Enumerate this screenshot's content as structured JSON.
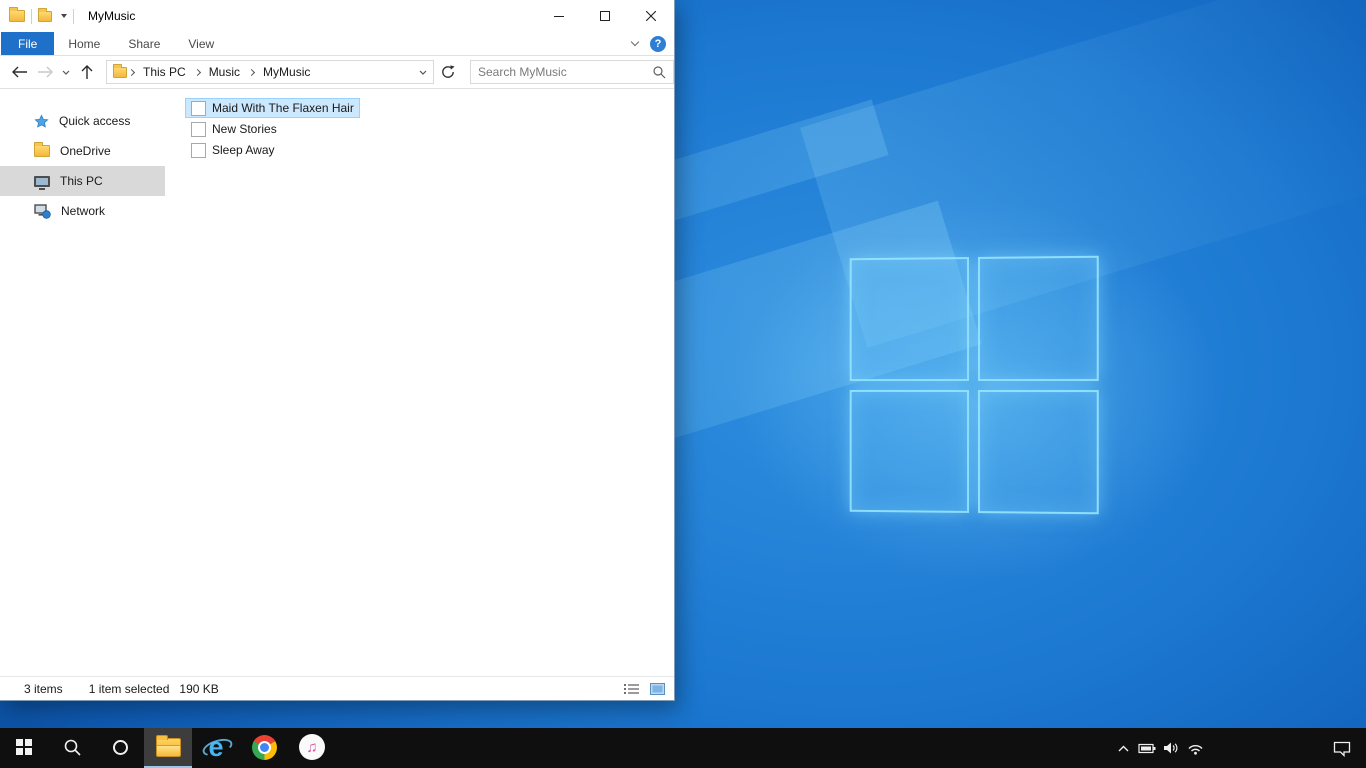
{
  "explorer": {
    "titlebar": {
      "title": "MyMusic"
    },
    "ribbon": {
      "tabs": [
        "File",
        "Home",
        "Share",
        "View"
      ],
      "help_glyph": "?"
    },
    "address": {
      "crumbs": [
        "This PC",
        "Music",
        "MyMusic"
      ]
    },
    "search": {
      "placeholder": "Search MyMusic"
    },
    "nav": {
      "items": [
        {
          "label": "Quick access",
          "icon": "star-icon"
        },
        {
          "label": "OneDrive",
          "icon": "folder-icon"
        },
        {
          "label": "This PC",
          "icon": "monitor-icon",
          "selected": true
        },
        {
          "label": "Network",
          "icon": "network-icon"
        }
      ]
    },
    "files": [
      {
        "name": "Maid With The Flaxen Hair",
        "icon": "media-file-icon",
        "selected": true
      },
      {
        "name": "New Stories",
        "icon": "media-file-icon",
        "selected": false
      },
      {
        "name": "Sleep Away",
        "icon": "media-file-icon",
        "selected": false
      }
    ],
    "statusbar": {
      "count": "3 items",
      "selection": "1 item selected",
      "size": "190 KB"
    }
  },
  "taskbar": {
    "apps": [
      "start",
      "search",
      "cortana",
      "file-explorer",
      "internet-explorer",
      "chrome",
      "itunes"
    ],
    "active_app": "file-explorer",
    "tray": [
      "show-hidden-icons",
      "battery",
      "volume",
      "wifi",
      "action-center"
    ]
  },
  "colors": {
    "file_tab_blue": "#1f70c8",
    "selection_bg": "#cce8ff",
    "selection_border": "#99d1ff",
    "nav_selected_gray": "#d9d9d9",
    "taskbar_black": "#0f0f0f",
    "wallpaper_mid_blue": "#2f8fe0",
    "logo_glow_cyan": "#8cd9ff"
  }
}
